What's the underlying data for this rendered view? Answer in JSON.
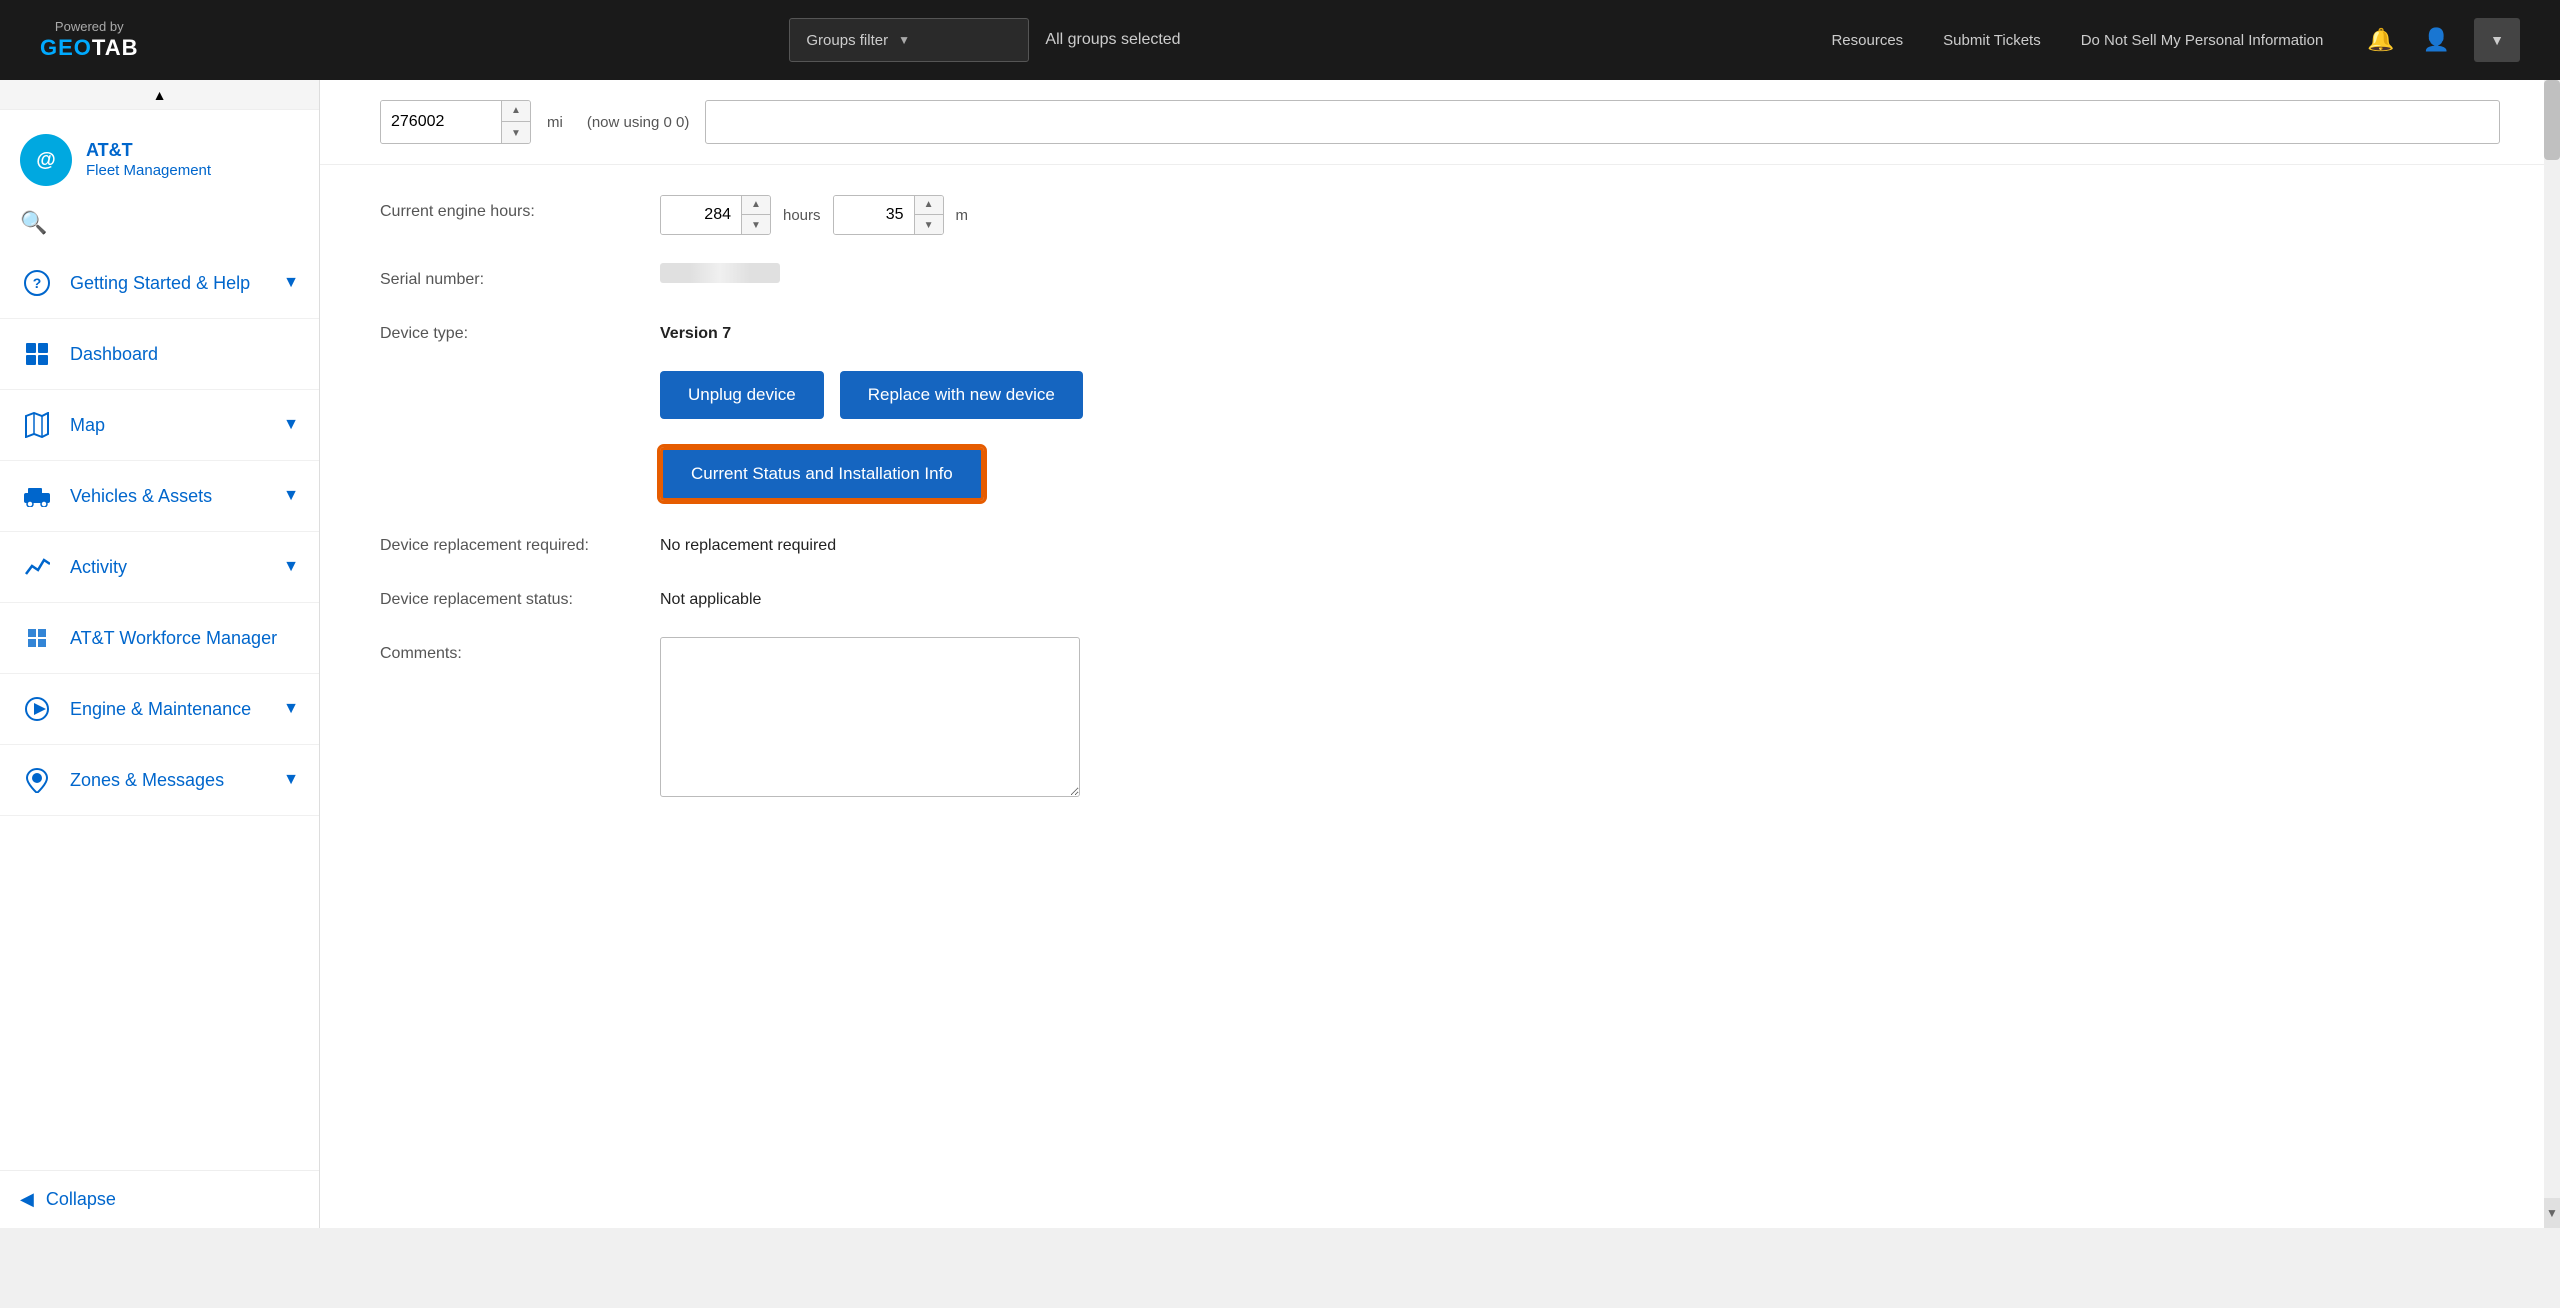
{
  "topnav": {
    "powered_by": "Powered by",
    "geotab": "GEOTAB",
    "resources_label": "Resources",
    "submit_tickets_label": "Submit Tickets",
    "do_not_sell_label": "Do Not Sell My Personal Information",
    "groups_filter_label": "Groups filter",
    "all_groups_selected": "All groups selected"
  },
  "sidebar": {
    "brand_name": "AT&T",
    "brand_sub": "Fleet Management",
    "items": [
      {
        "label": "Getting Started & Help",
        "icon": "?"
      },
      {
        "label": "Dashboard",
        "icon": "📊"
      },
      {
        "label": "Map",
        "icon": "🗺"
      },
      {
        "label": "Vehicles & Assets",
        "icon": "🚚"
      },
      {
        "label": "Activity",
        "icon": "📈"
      },
      {
        "label": "AT&T Workforce Manager",
        "icon": "🧩"
      },
      {
        "label": "Engine & Maintenance",
        "icon": "🎬"
      },
      {
        "label": "Zones & Messages",
        "icon": "📍"
      }
    ],
    "collapse_label": "Collapse"
  },
  "form": {
    "top_input_value": "276002",
    "top_unit": "mi",
    "top_note": "(now using 0 0)",
    "engine_hours_label": "Current engine hours:",
    "engine_hours_value": "284",
    "engine_minutes_value": "35",
    "hours_label": "hours",
    "minutes_label": "m",
    "serial_number_label": "Serial number:",
    "device_type_label": "Device type:",
    "device_type_value": "Version 7",
    "unplug_btn": "Unplug device",
    "replace_btn": "Replace with new device",
    "status_btn": "Current Status and Installation Info",
    "device_replacement_required_label": "Device replacement required:",
    "device_replacement_required_value": "No replacement required",
    "device_replacement_status_label": "Device replacement status:",
    "device_replacement_status_value": "Not applicable",
    "comments_label": "Comments:",
    "comments_placeholder": ""
  }
}
